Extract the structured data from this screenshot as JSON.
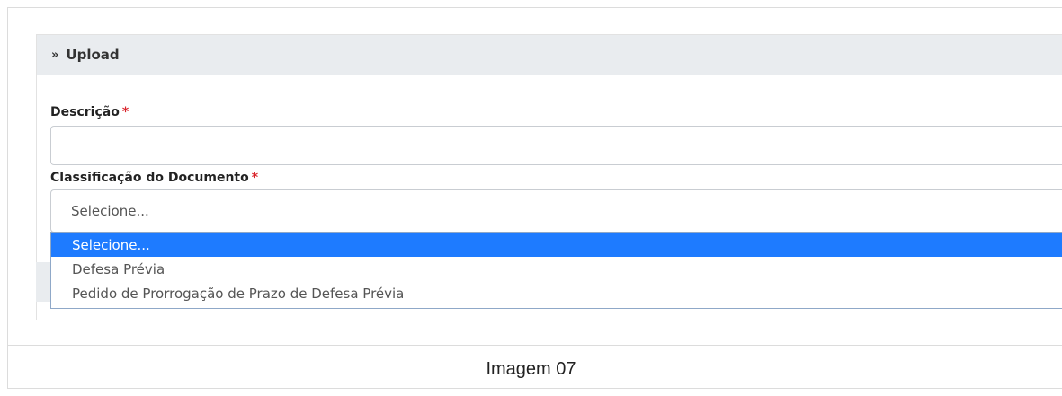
{
  "panel": {
    "title": "Upload",
    "chevron_icon": "double-chevron-down-icon"
  },
  "form": {
    "descricao": {
      "label": "Descrição",
      "required_mark": "*",
      "value": ""
    },
    "classificacao": {
      "label": "Classificação do Documento",
      "required_mark": "*",
      "selected": "Selecione...",
      "options": [
        "Selecione...",
        "Defesa Prévia",
        "Pedido de Prorrogação de Prazo de Defesa Prévia"
      ],
      "highlighted_index": 0
    }
  },
  "caption": "Imagem 07",
  "colors": {
    "highlight": "#1e7bff",
    "required": "#d9232a",
    "header_bg": "#e9ecef"
  }
}
